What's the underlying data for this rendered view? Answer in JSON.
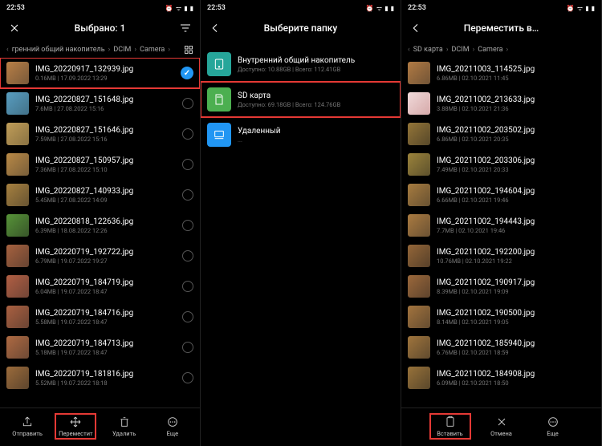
{
  "status": {
    "time": "22:53"
  },
  "col1": {
    "header_title": "Выбрано: 1",
    "breadcrumb": {
      "b0": "гренний общий накопитель",
      "b1": "DCIM",
      "b2": "Camera"
    },
    "files": [
      {
        "name": "IMG_20220917_132939.jpg",
        "meta": "0.16MB  |  17.09.2022 13:29",
        "selected": true,
        "hl": true,
        "hue": 30,
        "light": 50
      },
      {
        "name": "IMG_20220827_151648.jpg",
        "meta": "7.6MB  |  27.08.2022 15:16",
        "hue": 200,
        "light": 55
      },
      {
        "name": "IMG_20220827_151646.jpg",
        "meta": "7.59MB  |  27.08.2022 15:16",
        "hue": 40,
        "light": 55
      },
      {
        "name": "IMG_20220827_150957.jpg",
        "meta": "7.36MB  |  27.08.2022 15:10",
        "hue": 35,
        "light": 50
      },
      {
        "name": "IMG_20220827_140933.jpg",
        "meta": "5.45MB  |  27.08.2022 14:09",
        "hue": 38,
        "light": 45
      },
      {
        "name": "IMG_20220818_122636.jpg",
        "meta": "6.39MB  |  18.08.2022 12:26",
        "hue": 100,
        "light": 40
      },
      {
        "name": "IMG_20220719_192722.jpg",
        "meta": "6.79MB  |  19.07.2022 19:27",
        "hue": 20,
        "light": 45
      },
      {
        "name": "IMG_20220719_184719.jpg",
        "meta": "6.04MB  |  19.07.2022 18:47",
        "hue": 15,
        "light": 48
      },
      {
        "name": "IMG_20220719_184716.jpg",
        "meta": "5.58MB  |  19.07.2022 18:47",
        "hue": 18,
        "light": 46
      },
      {
        "name": "IMG_20220719_184713.jpg",
        "meta": "5.18MB  |  19.07.2022 18:47",
        "hue": 22,
        "light": 47
      },
      {
        "name": "IMG_20220719_181816.jpg",
        "meta": "5.52MB  |  19.07.2022 18:18",
        "hue": 30,
        "light": 42
      }
    ],
    "bottom": {
      "send": "Отправить",
      "move": "Переместит",
      "delete": "Удалить",
      "more": "Еще"
    }
  },
  "col2": {
    "header_title": "Выберите папку",
    "storages": [
      {
        "title": "Внутренний общий накопитель",
        "sub": "Доступно: 10.88GB | Всего: 112.41GB",
        "variant": "teal",
        "hl": false
      },
      {
        "title": "SD карта",
        "sub": "Доступно: 69.18GB | Всего: 124.76GB",
        "variant": "green",
        "hl": true
      },
      {
        "title": "Удаленный",
        "sub": "...",
        "variant": "blue",
        "hl": false
      }
    ]
  },
  "col3": {
    "header_title": "Переместить в…",
    "breadcrumb": {
      "b0": "SD карта",
      "b1": "DCIM",
      "b2": "Camera"
    },
    "files": [
      {
        "name": "IMG_20211003_114525.jpg",
        "meta": "6.86MB  |  02.10.2021 11:45",
        "hue": 30,
        "light": 48
      },
      {
        "name": "IMG_20211002_213633.jpg",
        "meta": "3.88MB  |  02.10.2021 21:36",
        "hue": 0,
        "light": 90
      },
      {
        "name": "IMG_20211002_203502.jpg",
        "meta": "6.86MB  |  02.10.2021 20:35",
        "hue": 40,
        "light": 40
      },
      {
        "name": "IMG_20211002_203306.jpg",
        "meta": "7.49MB  |  02.10.2021 20:33",
        "hue": 45,
        "light": 42
      },
      {
        "name": "IMG_20211002_194604.jpg",
        "meta": "6.66MB  |  02.10.2021 19:46",
        "hue": 35,
        "light": 45
      },
      {
        "name": "IMG_20211002_194443.jpg",
        "meta": "7.7MB  |  02.10.2021 19:46",
        "hue": 33,
        "light": 46
      },
      {
        "name": "IMG_20211002_192200.jpg",
        "meta": "10.76MB  |  02.10.2021 19:22",
        "hue": 30,
        "light": 40
      },
      {
        "name": "IMG_20211002_190917.jpg",
        "meta": "8.39MB  |  02.10.2021 19:09",
        "hue": 28,
        "light": 42
      },
      {
        "name": "IMG_20211002_190500.jpg",
        "meta": "8.14MB  |  02.10.2021 19:05",
        "hue": 32,
        "light": 44
      },
      {
        "name": "IMG_20211002_185940.jpg",
        "meta": "6.76MB  |  02.10.2021 18:59",
        "hue": 34,
        "light": 43
      },
      {
        "name": "IMG_20211002_184908.jpg",
        "meta": "6.09MB  |  02.10.2021 18:50",
        "hue": 36,
        "light": 41
      }
    ],
    "bottom": {
      "paste": "Вставить",
      "cancel": "Отмена",
      "more": "Еще"
    }
  }
}
